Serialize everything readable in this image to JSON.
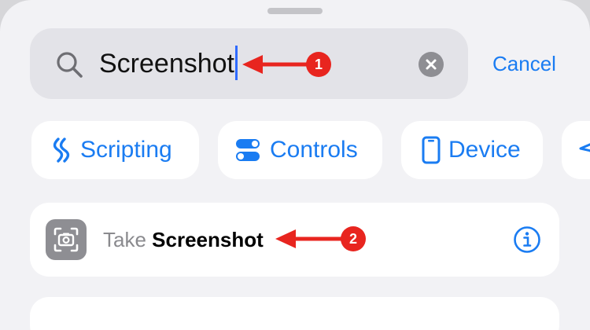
{
  "search": {
    "value": "Screenshot",
    "icon": "magnifying-glass-icon",
    "clear_icon": "clear-x-icon"
  },
  "cancel_label": "Cancel",
  "categories": [
    {
      "label": "Scripting",
      "icon": "scripting-icon"
    },
    {
      "label": "Controls",
      "icon": "toggle-icon"
    },
    {
      "label": "Device",
      "icon": "phone-icon"
    }
  ],
  "results": [
    {
      "prefix": "Take ",
      "highlight": "Screenshot",
      "icon": "screenshot-icon",
      "info_icon": "info-icon"
    }
  ],
  "annotations": [
    {
      "number": "1"
    },
    {
      "number": "2"
    }
  ],
  "colors": {
    "accent": "#1a7cf2",
    "annotation": "#e8251f",
    "caret": "#2f6bff"
  }
}
